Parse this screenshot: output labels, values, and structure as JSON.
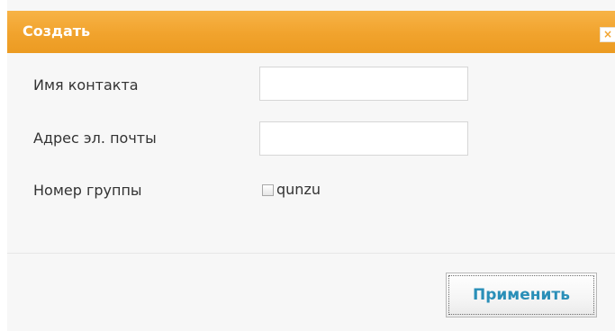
{
  "dialog": {
    "title": "Создать",
    "close_icon": "close-icon",
    "close_glyph": "×",
    "accent_color": "#f1a32d"
  },
  "form": {
    "contact_name": {
      "label": "Имя контакта",
      "value": "",
      "placeholder": ""
    },
    "email": {
      "label": "Адрес эл. почты",
      "value": "",
      "placeholder": ""
    },
    "group": {
      "label": "Номер группы",
      "options": [
        {
          "label": "qunzu",
          "checked": false
        }
      ]
    }
  },
  "footer": {
    "apply_label": "Применить",
    "apply_color": "#2a8fb8"
  }
}
